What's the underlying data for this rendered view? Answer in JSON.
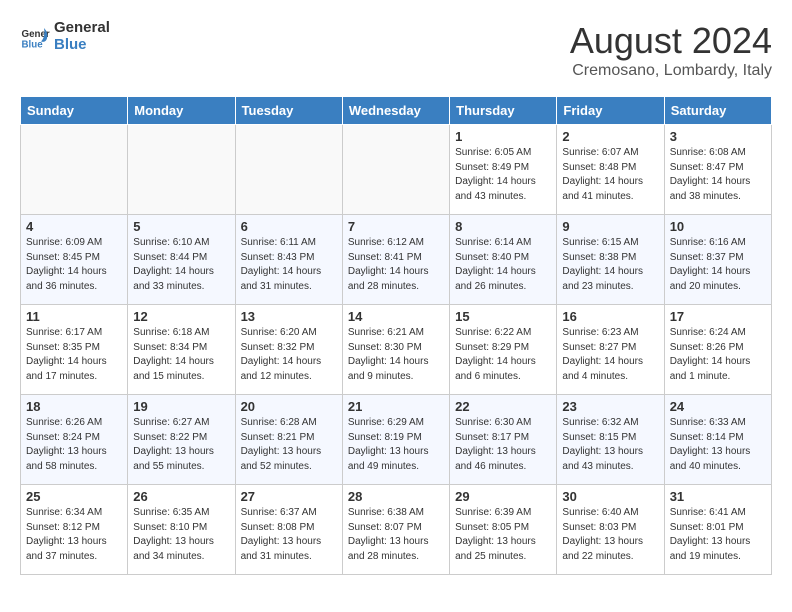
{
  "header": {
    "logo_line1": "General",
    "logo_line2": "Blue",
    "month_year": "August 2024",
    "location": "Cremosano, Lombardy, Italy"
  },
  "days_of_week": [
    "Sunday",
    "Monday",
    "Tuesday",
    "Wednesday",
    "Thursday",
    "Friday",
    "Saturday"
  ],
  "weeks": [
    [
      {
        "day": "",
        "info": ""
      },
      {
        "day": "",
        "info": ""
      },
      {
        "day": "",
        "info": ""
      },
      {
        "day": "",
        "info": ""
      },
      {
        "day": "1",
        "info": "Sunrise: 6:05 AM\nSunset: 8:49 PM\nDaylight: 14 hours\nand 43 minutes."
      },
      {
        "day": "2",
        "info": "Sunrise: 6:07 AM\nSunset: 8:48 PM\nDaylight: 14 hours\nand 41 minutes."
      },
      {
        "day": "3",
        "info": "Sunrise: 6:08 AM\nSunset: 8:47 PM\nDaylight: 14 hours\nand 38 minutes."
      }
    ],
    [
      {
        "day": "4",
        "info": "Sunrise: 6:09 AM\nSunset: 8:45 PM\nDaylight: 14 hours\nand 36 minutes."
      },
      {
        "day": "5",
        "info": "Sunrise: 6:10 AM\nSunset: 8:44 PM\nDaylight: 14 hours\nand 33 minutes."
      },
      {
        "day": "6",
        "info": "Sunrise: 6:11 AM\nSunset: 8:43 PM\nDaylight: 14 hours\nand 31 minutes."
      },
      {
        "day": "7",
        "info": "Sunrise: 6:12 AM\nSunset: 8:41 PM\nDaylight: 14 hours\nand 28 minutes."
      },
      {
        "day": "8",
        "info": "Sunrise: 6:14 AM\nSunset: 8:40 PM\nDaylight: 14 hours\nand 26 minutes."
      },
      {
        "day": "9",
        "info": "Sunrise: 6:15 AM\nSunset: 8:38 PM\nDaylight: 14 hours\nand 23 minutes."
      },
      {
        "day": "10",
        "info": "Sunrise: 6:16 AM\nSunset: 8:37 PM\nDaylight: 14 hours\nand 20 minutes."
      }
    ],
    [
      {
        "day": "11",
        "info": "Sunrise: 6:17 AM\nSunset: 8:35 PM\nDaylight: 14 hours\nand 17 minutes."
      },
      {
        "day": "12",
        "info": "Sunrise: 6:18 AM\nSunset: 8:34 PM\nDaylight: 14 hours\nand 15 minutes."
      },
      {
        "day": "13",
        "info": "Sunrise: 6:20 AM\nSunset: 8:32 PM\nDaylight: 14 hours\nand 12 minutes."
      },
      {
        "day": "14",
        "info": "Sunrise: 6:21 AM\nSunset: 8:30 PM\nDaylight: 14 hours\nand 9 minutes."
      },
      {
        "day": "15",
        "info": "Sunrise: 6:22 AM\nSunset: 8:29 PM\nDaylight: 14 hours\nand 6 minutes."
      },
      {
        "day": "16",
        "info": "Sunrise: 6:23 AM\nSunset: 8:27 PM\nDaylight: 14 hours\nand 4 minutes."
      },
      {
        "day": "17",
        "info": "Sunrise: 6:24 AM\nSunset: 8:26 PM\nDaylight: 14 hours\nand 1 minute."
      }
    ],
    [
      {
        "day": "18",
        "info": "Sunrise: 6:26 AM\nSunset: 8:24 PM\nDaylight: 13 hours\nand 58 minutes."
      },
      {
        "day": "19",
        "info": "Sunrise: 6:27 AM\nSunset: 8:22 PM\nDaylight: 13 hours\nand 55 minutes."
      },
      {
        "day": "20",
        "info": "Sunrise: 6:28 AM\nSunset: 8:21 PM\nDaylight: 13 hours\nand 52 minutes."
      },
      {
        "day": "21",
        "info": "Sunrise: 6:29 AM\nSunset: 8:19 PM\nDaylight: 13 hours\nand 49 minutes."
      },
      {
        "day": "22",
        "info": "Sunrise: 6:30 AM\nSunset: 8:17 PM\nDaylight: 13 hours\nand 46 minutes."
      },
      {
        "day": "23",
        "info": "Sunrise: 6:32 AM\nSunset: 8:15 PM\nDaylight: 13 hours\nand 43 minutes."
      },
      {
        "day": "24",
        "info": "Sunrise: 6:33 AM\nSunset: 8:14 PM\nDaylight: 13 hours\nand 40 minutes."
      }
    ],
    [
      {
        "day": "25",
        "info": "Sunrise: 6:34 AM\nSunset: 8:12 PM\nDaylight: 13 hours\nand 37 minutes."
      },
      {
        "day": "26",
        "info": "Sunrise: 6:35 AM\nSunset: 8:10 PM\nDaylight: 13 hours\nand 34 minutes."
      },
      {
        "day": "27",
        "info": "Sunrise: 6:37 AM\nSunset: 8:08 PM\nDaylight: 13 hours\nand 31 minutes."
      },
      {
        "day": "28",
        "info": "Sunrise: 6:38 AM\nSunset: 8:07 PM\nDaylight: 13 hours\nand 28 minutes."
      },
      {
        "day": "29",
        "info": "Sunrise: 6:39 AM\nSunset: 8:05 PM\nDaylight: 13 hours\nand 25 minutes."
      },
      {
        "day": "30",
        "info": "Sunrise: 6:40 AM\nSunset: 8:03 PM\nDaylight: 13 hours\nand 22 minutes."
      },
      {
        "day": "31",
        "info": "Sunrise: 6:41 AM\nSunset: 8:01 PM\nDaylight: 13 hours\nand 19 minutes."
      }
    ]
  ]
}
